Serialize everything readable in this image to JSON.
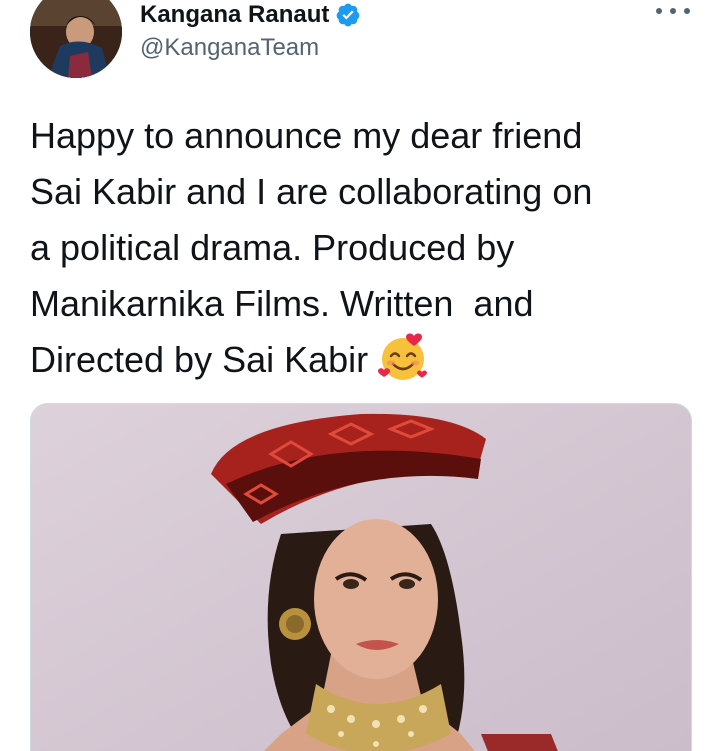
{
  "author": {
    "display_name": "Kangana Ranaut",
    "handle": "@KanganaTeam",
    "verified": true,
    "verified_color": "#1d9bf0"
  },
  "tweet": {
    "text_lines": [
      "Happy to announce my dear friend",
      "Sai Kabir and I are collaborating on",
      "a political drama. Produced by",
      "Manikarnika Films. Written  and",
      "Directed by Sai Kabir"
    ],
    "emoji": "smiling-face-with-hearts"
  },
  "icons": {
    "more": "more-options-icon",
    "verified": "verified-badge-icon"
  }
}
